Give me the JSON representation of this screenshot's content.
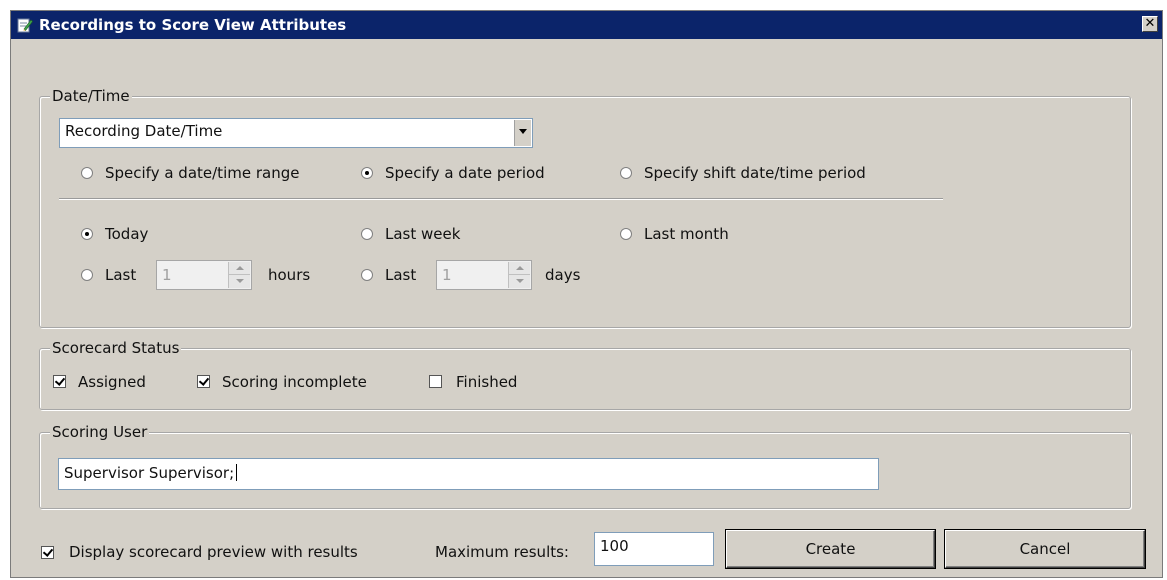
{
  "window": {
    "title": "Recordings to Score View Attributes",
    "close_label": "✕"
  },
  "datetime": {
    "legend": "Date/Time",
    "dropdown_value": "Recording Date/Time",
    "mode_options": [
      {
        "label": "Specify a date/time range",
        "checked": false
      },
      {
        "label": "Specify a date period",
        "checked": true
      },
      {
        "label": "Specify shift date/time period",
        "checked": false
      }
    ],
    "period": {
      "today": "Today",
      "last_week": "Last week",
      "last_month": "Last month",
      "last_label": "Last",
      "hours_value": "1",
      "hours_unit": "hours",
      "days_value": "1",
      "days_unit": "days",
      "selected": "Today"
    }
  },
  "scorecard_status": {
    "legend": "Scorecard Status",
    "options": [
      {
        "label": "Assigned",
        "checked": true
      },
      {
        "label": "Scoring incomplete",
        "checked": true
      },
      {
        "label": "Finished",
        "checked": false
      }
    ]
  },
  "scoring_user": {
    "legend": "Scoring User",
    "value": "Supervisor Supervisor;"
  },
  "footer": {
    "preview_label": "Display scorecard preview with results",
    "preview_checked": true,
    "max_results_label": "Maximum results:",
    "max_results_value": "100",
    "create_label": "Create",
    "cancel_label": "Cancel"
  },
  "colors": {
    "titlebar": "#0b246a",
    "dialog_bg": "#d4d0c8"
  }
}
